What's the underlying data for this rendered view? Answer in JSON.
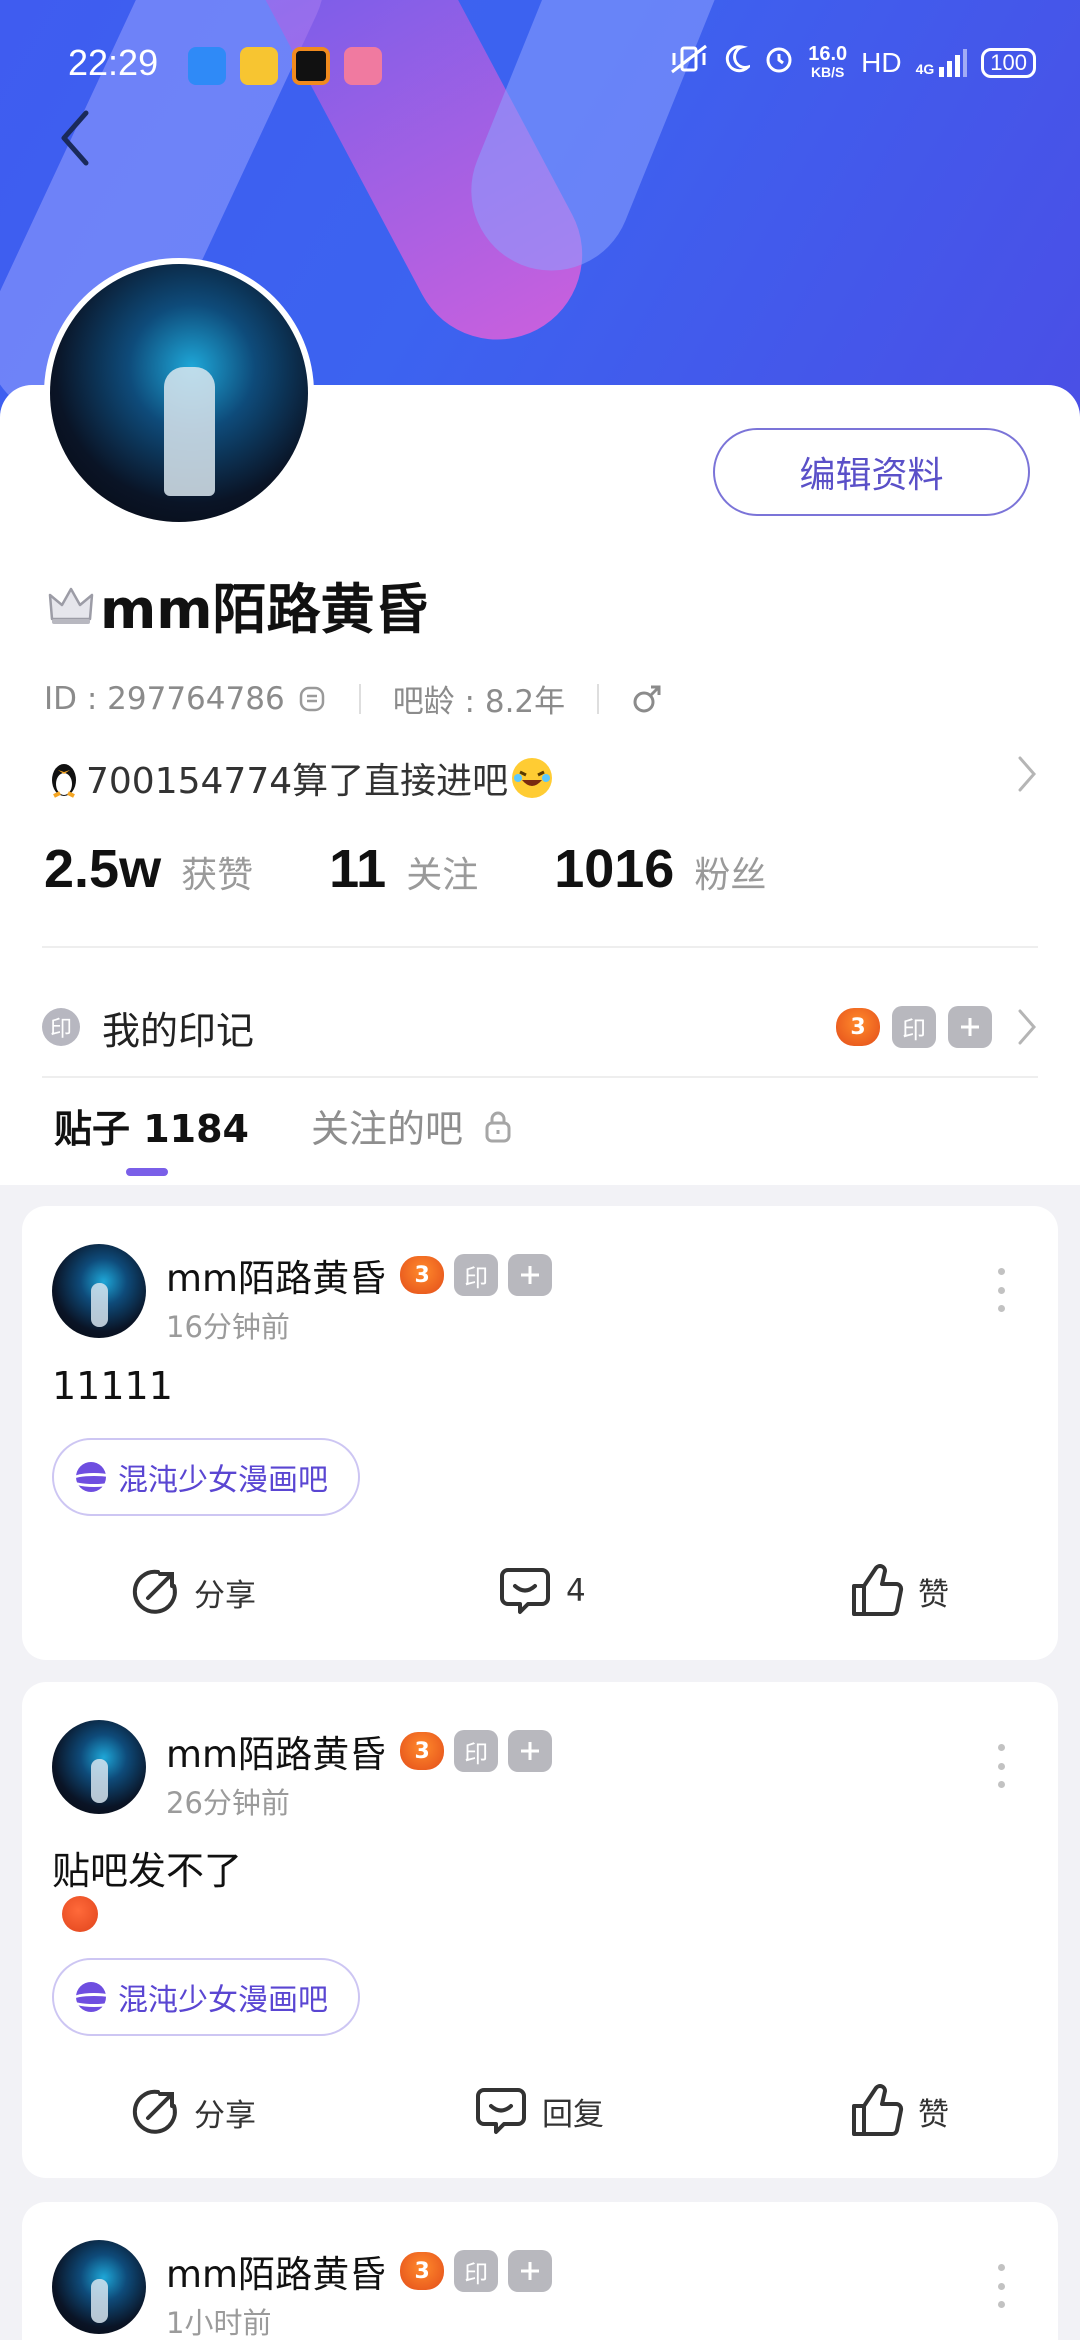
{
  "status_bar": {
    "time": "22:29",
    "net_speed_value": "16.0",
    "net_speed_unit": "KB/S",
    "hd": "HD",
    "signal": "4G",
    "battery": "100"
  },
  "profile": {
    "edit_button": "编辑资料",
    "username": "mm陌路黄昏",
    "id_text": "ID : 297764786",
    "age_text": "吧龄 : 8.2年",
    "bio": "700154774算了直接进吧",
    "stats": [
      {
        "value": "2.5w",
        "label": "获赞"
      },
      {
        "value": "11",
        "label": "关注"
      },
      {
        "value": "1016",
        "label": "粉丝"
      }
    ],
    "mark_icon": "印",
    "mark_label": "我的印记",
    "badge_num": "3",
    "badge_seal": "印"
  },
  "tabs": {
    "posts": "贴子 1184",
    "followed_bars": "关注的吧"
  },
  "posts": [
    {
      "author": "mm陌路黄昏",
      "badge_num": "3",
      "badge_seal": "印",
      "time": "16分钟前",
      "content": "11111",
      "tag": "混沌少女漫画吧",
      "share": "分享",
      "comments": "4",
      "like": "赞"
    },
    {
      "author": "mm陌路黄昏",
      "badge_num": "3",
      "badge_seal": "印",
      "time": "26分钟前",
      "content": "贴吧发不了",
      "tag": "混沌少女漫画吧",
      "share": "分享",
      "comments": "回复",
      "like": "赞"
    },
    {
      "author": "mm陌路黄昏",
      "badge_num": "3",
      "badge_seal": "印",
      "time": "1小时前"
    }
  ],
  "colors": {
    "accent": "#5a50c8",
    "banner": "#3f5cf0",
    "tab_indicator": "#7a5fe8"
  }
}
